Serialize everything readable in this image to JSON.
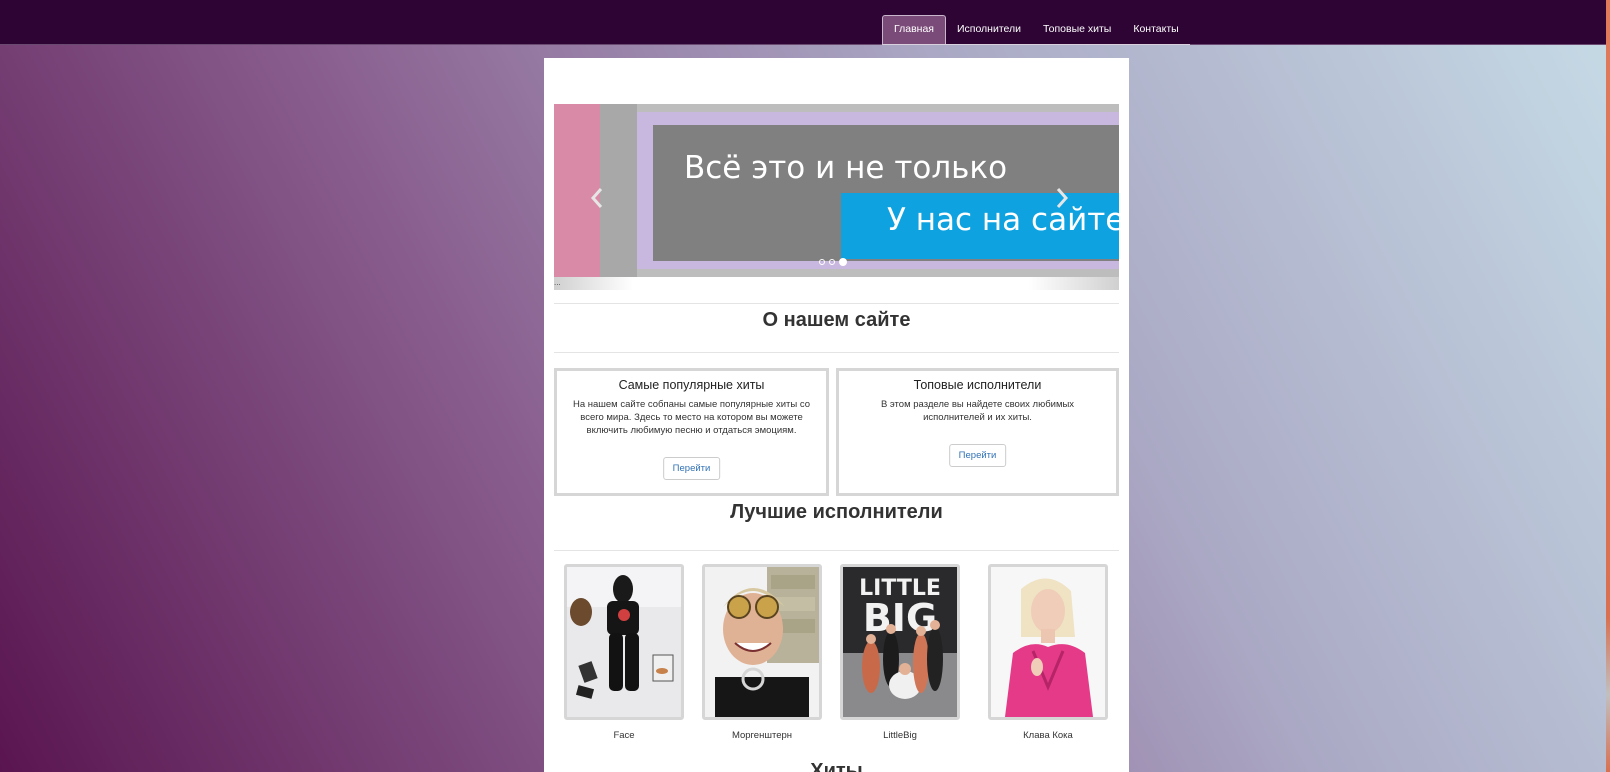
{
  "nav": {
    "items": [
      {
        "label": "Главная",
        "active": true
      },
      {
        "label": "Исполнители",
        "active": false
      },
      {
        "label": "Топовые хиты",
        "active": false
      },
      {
        "label": "Контакты",
        "active": false
      }
    ]
  },
  "carousel": {
    "slide_text_1": "Всё это и не только",
    "slide_text_2": "У нас на сайте",
    "caption": "...",
    "indicators": 3,
    "active_indicator": 3
  },
  "about": {
    "title": "О нашем сайте",
    "cards": [
      {
        "title": "Самые популярные хиты",
        "text": "На нашем сайте собпаны самые популярные хиты со всего мира. Здесь то место на котором вы можете включить любимую песню и отдаться эмоциям.",
        "button": "Перейти"
      },
      {
        "title": "Топовые исполнители",
        "text": "В этом разделе вы найдете своих любимых исполнителей и их хиты.",
        "button": "Перейти"
      }
    ]
  },
  "artists": {
    "title": "Лучшие исполнители",
    "items": [
      {
        "name": "Face"
      },
      {
        "name": "Моргенштерн"
      },
      {
        "name": "LittleBig",
        "poster_text_1": "LITTLE",
        "poster_text_2": "BIG"
      },
      {
        "name": "Клава Кока"
      }
    ]
  },
  "hits": {
    "title": "Хиты"
  },
  "colors": {
    "navbar": "#2d0434",
    "active_tab": "#7a4a78",
    "accent_blue": "#0ea2e0",
    "link": "#3172b6"
  }
}
